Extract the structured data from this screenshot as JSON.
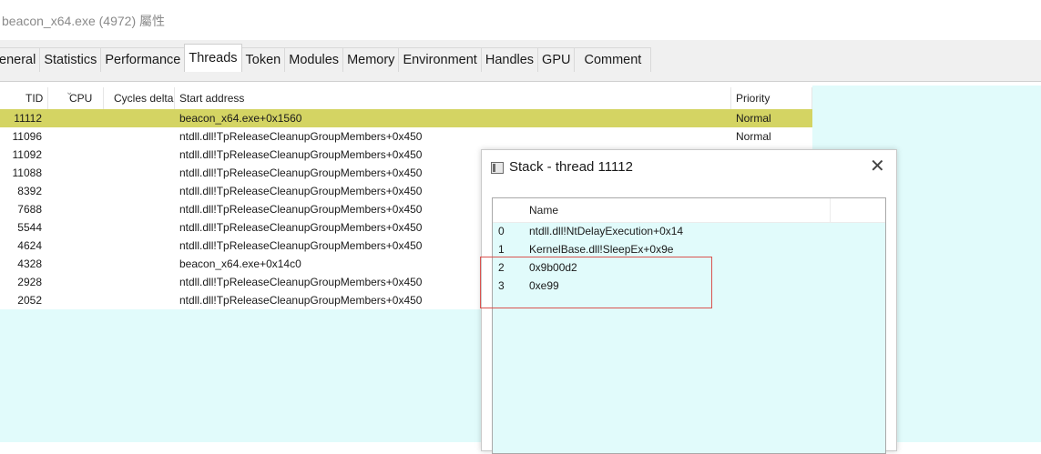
{
  "window": {
    "title": "beacon_x64.exe (4972) 屬性"
  },
  "tabs": [
    {
      "label": "eneral"
    },
    {
      "label": "Statistics"
    },
    {
      "label": "Performance"
    },
    {
      "label": "Threads",
      "active": true
    },
    {
      "label": "Token"
    },
    {
      "label": "Modules"
    },
    {
      "label": "Memory"
    },
    {
      "label": "Environment"
    },
    {
      "label": "Handles"
    },
    {
      "label": "GPU"
    },
    {
      "label": "Comment"
    }
  ],
  "threads": {
    "columns": {
      "tid": "TID",
      "cpu": "CPU",
      "cycles": "Cycles delta",
      "start": "Start address",
      "priority": "Priority"
    },
    "rows": [
      {
        "tid": "11112",
        "start": "beacon_x64.exe+0x1560",
        "priority": "Normal",
        "selected": true
      },
      {
        "tid": "11096",
        "start": "ntdll.dll!TpReleaseCleanupGroupMembers+0x450",
        "priority": "Normal"
      },
      {
        "tid": "11092",
        "start": "ntdll.dll!TpReleaseCleanupGroupMembers+0x450",
        "priority": ""
      },
      {
        "tid": "11088",
        "start": "ntdll.dll!TpReleaseCleanupGroupMembers+0x450",
        "priority": ""
      },
      {
        "tid": "8392",
        "start": "ntdll.dll!TpReleaseCleanupGroupMembers+0x450",
        "priority": ""
      },
      {
        "tid": "7688",
        "start": "ntdll.dll!TpReleaseCleanupGroupMembers+0x450",
        "priority": ""
      },
      {
        "tid": "5544",
        "start": "ntdll.dll!TpReleaseCleanupGroupMembers+0x450",
        "priority": ""
      },
      {
        "tid": "4624",
        "start": "ntdll.dll!TpReleaseCleanupGroupMembers+0x450",
        "priority": ""
      },
      {
        "tid": "4328",
        "start": "beacon_x64.exe+0x14c0",
        "priority": ""
      },
      {
        "tid": "2928",
        "start": "ntdll.dll!TpReleaseCleanupGroupMembers+0x450",
        "priority": ""
      },
      {
        "tid": "2052",
        "start": "ntdll.dll!TpReleaseCleanupGroupMembers+0x450",
        "priority": ""
      }
    ]
  },
  "stack_dialog": {
    "title": "Stack - thread 11112",
    "close_glyph": "✕",
    "column_name": "Name",
    "frames": [
      {
        "num": "0",
        "name": "ntdll.dll!NtDelayExecution+0x14"
      },
      {
        "num": "1",
        "name": "KernelBase.dll!SleepEx+0x9e"
      },
      {
        "num": "2",
        "name": "0x9b00d2"
      },
      {
        "num": "3",
        "name": "0xe99"
      }
    ]
  },
  "colors": {
    "selected_row": "#d4d463",
    "empty_area": "#e1fbfb",
    "highlight_box": "#d9534f"
  }
}
